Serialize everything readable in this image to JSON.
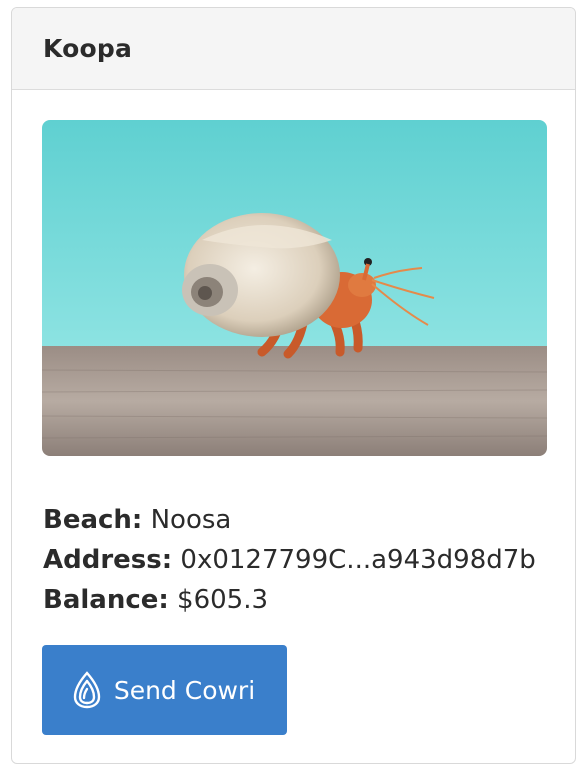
{
  "card": {
    "title": "Koopa",
    "image_alt": "Hermit crab in shell on a wooden surface",
    "details": [
      {
        "label": "Beach:",
        "value": "Noosa"
      },
      {
        "label": "Address:",
        "value": "0x0127799C...a943d98d7b"
      },
      {
        "label": "Balance:",
        "value": "$605.3"
      }
    ],
    "send_button": {
      "label": "Send Cowri",
      "icon": "cowri-shell-icon"
    }
  },
  "colors": {
    "header_bg": "#f5f5f5",
    "button_bg": "#3a7fcb",
    "sky": "#63d0d2",
    "text": "#2b2b2b"
  }
}
